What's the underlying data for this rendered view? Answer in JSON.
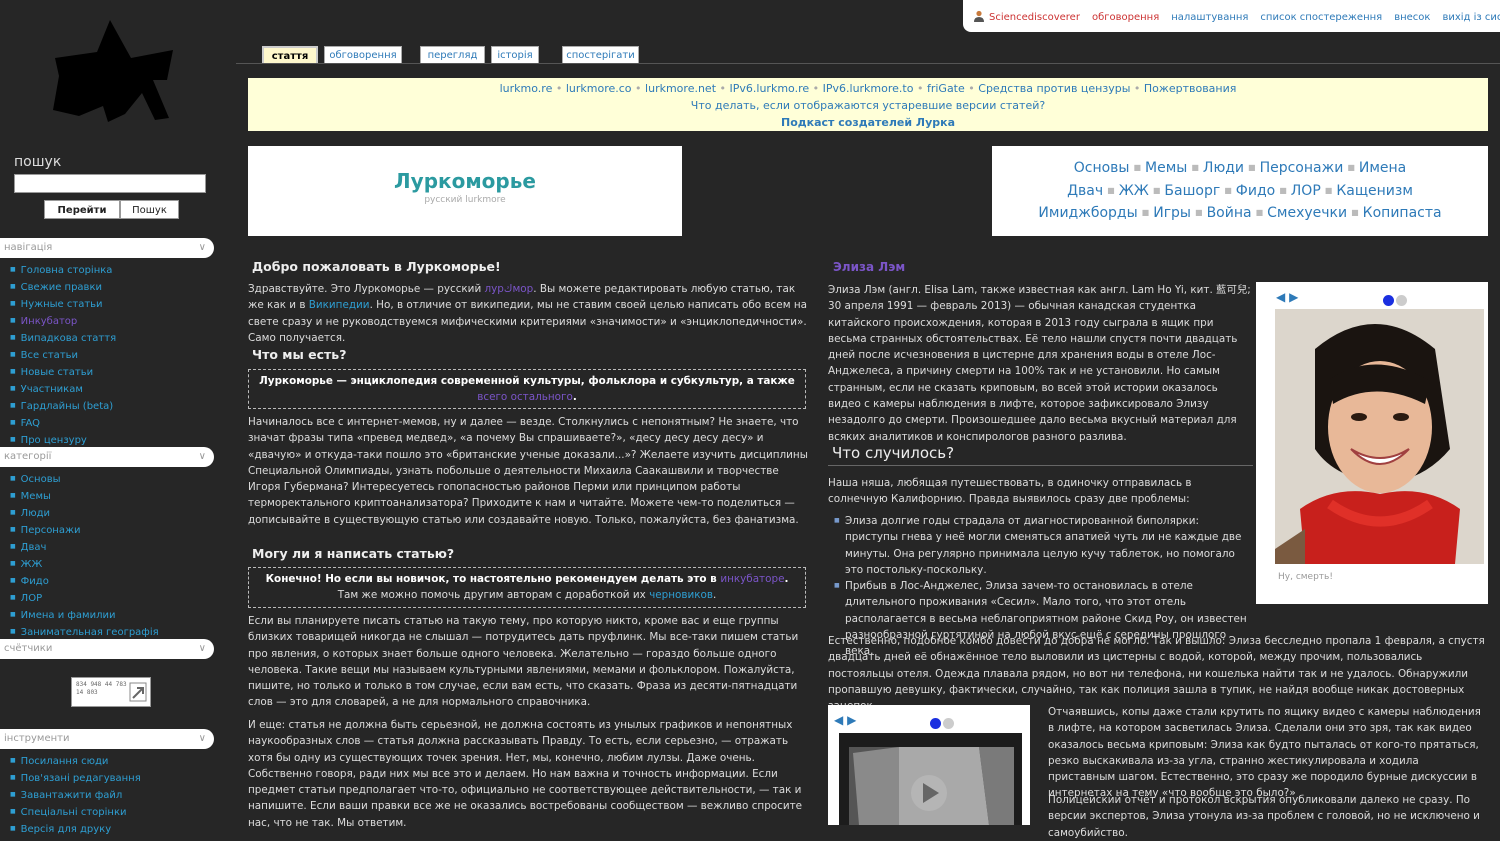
{
  "personal": {
    "user": "Sciencediscoverer",
    "items": [
      "обговорення",
      "налаштування",
      "список спостереження",
      "внесок",
      "вихід із системи"
    ]
  },
  "search": {
    "label": "пошук",
    "go": "Перейти",
    "search": "Пошук"
  },
  "sidebar": {
    "navigation": {
      "title": "навігація",
      "items": [
        {
          "label": "Головна сторінка",
          "visited": false
        },
        {
          "label": "Свежие правки",
          "visited": false
        },
        {
          "label": "Нужные статьи",
          "visited": false
        },
        {
          "label": "Инкубатор",
          "visited": true
        },
        {
          "label": "Випадкова стаття",
          "visited": false
        },
        {
          "label": "Все статьи",
          "visited": false
        },
        {
          "label": "Новые статьи",
          "visited": false
        },
        {
          "label": "Участникам",
          "visited": false
        },
        {
          "label": "Гардлайны (beta)",
          "visited": false
        },
        {
          "label": "FAQ",
          "visited": false
        },
        {
          "label": "Про цензуру",
          "visited": false
        }
      ]
    },
    "categories": {
      "title": "категорії",
      "items": [
        "Основы",
        "Мемы",
        "Люди",
        "Персонажи",
        "Двач",
        "ЖЖ",
        "Фидо",
        "ЛОР",
        "Имена и фамилии",
        "Занимательная географія"
      ]
    },
    "counters": {
      "title": "счётчики",
      "widget_text": "834 948 44 783 14 803"
    },
    "tools": {
      "title": "інструменти",
      "items": [
        "Посилання сюди",
        "Пов'язані редагування",
        "Завантажити файл",
        "Спеціальні сторінки",
        "Версія для друку"
      ]
    }
  },
  "tabs": [
    "стаття",
    "обговорення",
    "перегляд",
    "історія",
    "спостерігати"
  ],
  "notice": {
    "links": [
      "lurkmo.re",
      "lurkmore.co",
      "lurkmore.net",
      "IPv6.lurkmo.re",
      "IPv6.lurkmore.to",
      "friGate",
      "Средства против цензуры",
      "Пожертвования"
    ],
    "line2": "Что делать, если отображаются устаревшие версии статей?",
    "line3": "Подкаст создателей Лурка"
  },
  "brand": {
    "title": "Луркоморье",
    "subtitle": "русский lurkmore"
  },
  "categories_box": {
    "row1": [
      "Основы",
      "Мемы",
      "Люди",
      "Персонажи",
      "Имена"
    ],
    "row2": [
      "Двач",
      "ЖЖ",
      "Башорг",
      "Фидо",
      "ЛОР",
      "Кащенизм"
    ],
    "row3": [
      "Имиджборды",
      "Игры",
      "Война",
      "Смехуечки",
      "Копипаста"
    ]
  },
  "left": {
    "welcome_title": "Добро пожаловать в Луркоморье!",
    "welcome_p1": "Здравствуйте. Это Луркоморье — русский ",
    "welcome_link1": "лурكмор",
    "welcome_p2": ". Вы можете редактировать любую статью, так же как и в ",
    "welcome_link2": "Википедии",
    "welcome_p3": ". Но, в отличие от википедии, мы не ставим своей целью написать обо всем на свете сразу и не руководствуемся мифическими критериями «значимости» и «энциклопедичности». Само получается.",
    "what_title": "Что мы есть?",
    "what_box": "Луркоморье — энциклопедия современной культуры, фольклора и субкультур, а также ",
    "what_box_link": "всего остального",
    "what_text": "Начиналось все с интернет-мемов, ну и далее — везде. Столкнулись с непонятным? Не знаете, что значат фразы типа «превед медвед», «а почему Вы спрашиваете?», «десу десу десу десу» и «двачую» и откуда-таки пошло это «британские ученые доказали...»? Желаете изучить дисциплины Специальной Олимпиады, узнать побольше о деятельности Михаила Саакашвили и творчестве Игоря Губермана? Интересуетесь гопопасностью районов Перми или принципом работы терморектального криптоанализатора? Приходите к нам и читайте. Можете чем-то поделиться — дописывайте в существующую статью или создавайте новую. Только, пожалуйста, без фанатизма.",
    "can_title": "Могу ли я написать статью?",
    "can_box_1": "Конечно! Но если вы новичок, то настоятельно рекомендуем делать это в ",
    "can_box_link": "инкубаторе",
    "can_box_2": "Там же можно помочь другим авторам с доработкой их ",
    "can_box_link2": "черновиков",
    "can_text1": "Если вы планируете писать статью на такую тему, про которую никто, кроме вас и еще группы близких товарищей никогда не слышал — потрудитесь дать пруфлинк. Мы все-таки пишем статьи про явления, о которых знает больше одного человека. Желательно — гораздо больше одного человека. Такие вещи мы называем культурными явлениями, мемами и фольклором. Пожалуйста, пишите, но только и только в том случае, если вам есть, что сказать. Фраза из десяти-пятнадцати слов — это для словарей, а не для нормального справочника.",
    "can_text2": "И еще: статья не должна быть серьезной, не должна состоять из унылых графиков и непонятных наукообразных слов — статья должна рассказывать Правду. То есть, если серьезно, — отражать хотя бы одну из существующих точек зрения. Нет, мы, конечно, любим лулзы. Даже очень. Собственно говоря, ради них мы все это и делаем. Но нам важна и точность информации. Если предмет статьи предполагает что-то, официально не соответствующее действительности, — так и напишите. Если ваши правки все же не оказались востребованы сообществом — вежливо спросите нас, что не так. Мы ответим."
  },
  "right": {
    "featured_title": "Элиза Лэм",
    "intro": "Элиза Лэм (англ. Elisa Lam, также известная как англ. Lam Ho Yi, кит. 藍可兒; 30 апреля 1991 — февраль 2013) — обычная канадская студентка китайского происхождения, которая в 2013 году сыграла в ящик при весьма странных обстоятельствах. Её тело нашли спустя почти двадцать дней после исчезновения в цистерне для хранения воды в отеле Лос-Анджелеса, а причину смерти на 100% так и не установили. Но самым странным, если не сказать криповым, во всей этой истории оказалось видео с камеры наблюдения в лифте, которое зафиксировало Элизу незадолго до смерти. Произошедшее дало весьма вкусный материал для всяких аналитиков и конспирологов разного разлива.",
    "image_caption": "Ну, смерть!",
    "section_title": "Что случилось?",
    "section_p1": "Наша няша, любящая путешествовать, в одиночку отправилась в солнечную Калифорнию. Правда выявилось сразу две проблемы:",
    "bullets": [
      "Элиза долгие годы страдала от диагностированной биполярки: приступы гнева у неё могли сменяться апатией чуть ли не каждые две минуты. Она регулярно принимала целую кучу таблеток, но помогало это постольку-поскольку.",
      "Прибыв в Лос-Анджелес, Элиза зачем-то остановилась в отеле длительного проживания «Сесил». Мало того, что этот отель располагается в весьма неблагоприятном районе Скид Роу, он известен разнообразной гуртятиной на любой вкус ещё с середины прошлого века."
    ],
    "p2": "Естественно, подобное комбо довести до добра не могло. Так и вышло: Элиза бесследно пропала 1 февраля, а спустя двадцать дней её обнажённое тело выловили из цистерны с водой, которой, между прочим, пользовались постояльцы отеля. Одежда плавала рядом, но вот ни телефона, ни кошелька найти так и не удалось. Обнаружили пропавшую девушку, фактически, случайно, так как полиция зашла в тупик, не найдя вообще никак достоверных зацепок.",
    "p3": "Отчаявшись, копы даже стали крутить по ящику видео с камеры наблюдения в лифте, на котором засветилась Элиза. Сделали они это зря, так как видео оказалось весьма криповым: Элиза как будто пыталась от кого-то прятаться, резко выскакивала из-за угла, странно жестикулировала и ходила приставным шагом. Естественно, это сразу же породило бурные дискуссии в интернетах на тему «что вообще это было?»",
    "p4": "Полицейский отчёт и протокол вскрытия опубликовали далеко не сразу. По версии экспертов, Элиза утонула из-за проблем с головой, но не исключено и самоубийство."
  }
}
